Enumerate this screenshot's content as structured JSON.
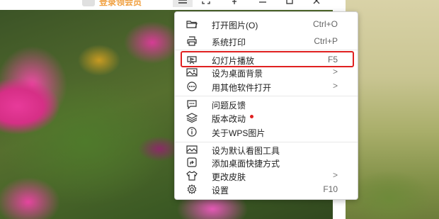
{
  "header": {
    "login_label": "登录领会员"
  },
  "menu": {
    "items": [
      {
        "label": "打开图片(O)",
        "shortcut": "Ctrl+O",
        "icon": "folder-open-icon"
      },
      {
        "label": "系统打印",
        "shortcut": "Ctrl+P",
        "icon": "printer-icon"
      },
      {
        "label": "幻灯片播放",
        "shortcut": "F5",
        "icon": "slideshow-icon"
      },
      {
        "label": "设为桌面背景",
        "arrow": ">",
        "icon": "wallpaper-icon"
      },
      {
        "label": "用其他软件打开",
        "arrow": ">",
        "icon": "more-icon"
      },
      {
        "label": "问题反馈",
        "icon": "feedback-icon"
      },
      {
        "label": "版本改动",
        "icon": "layers-icon",
        "badge": "new-dot"
      },
      {
        "label": "关于WPS图片",
        "icon": "info-icon"
      },
      {
        "label": "设为默认看图工具",
        "icon": "default-viewer-icon"
      },
      {
        "label": "添加桌面快捷方式",
        "icon": "shortcut-icon"
      },
      {
        "label": "更改皮肤",
        "arrow": ">",
        "icon": "shirt-icon"
      },
      {
        "label": "设置",
        "shortcut": "F10",
        "icon": "gear-icon"
      }
    ]
  },
  "colors": {
    "highlight_border": "#e02020",
    "header_text": "#f0a040"
  }
}
